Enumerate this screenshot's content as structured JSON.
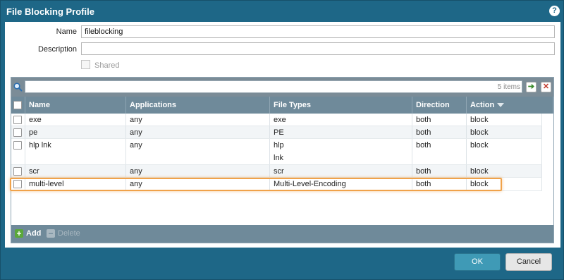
{
  "dialog": {
    "title": "File Blocking Profile",
    "help_icon": "help-icon"
  },
  "form": {
    "name_label": "Name",
    "name_value": "fileblocking",
    "description_label": "Description",
    "description_value": "",
    "shared_label": "Shared",
    "shared_checked": false
  },
  "grid": {
    "filter_value": "",
    "item_count": "5 items",
    "columns": [
      "Name",
      "Applications",
      "File Types",
      "Direction",
      "Action"
    ],
    "sorted_column": "Action",
    "rows": [
      {
        "name": "exe",
        "applications": "any",
        "file_types": [
          "exe"
        ],
        "direction": "both",
        "action": "block"
      },
      {
        "name": "pe",
        "applications": "any",
        "file_types": [
          "PE"
        ],
        "direction": "both",
        "action": "block"
      },
      {
        "name": "hlp lnk",
        "applications": "any",
        "file_types": [
          "hlp",
          "lnk"
        ],
        "direction": "both",
        "action": "block"
      },
      {
        "name": "scr",
        "applications": "any",
        "file_types": [
          "scr"
        ],
        "direction": "both",
        "action": "block"
      },
      {
        "name": "multi-level",
        "applications": "any",
        "file_types": [
          "Multi-Level-Encoding"
        ],
        "direction": "both",
        "action": "block"
      }
    ],
    "highlighted_row": "multi-level",
    "add_label": "Add",
    "delete_label": "Delete"
  },
  "buttons": {
    "ok_label": "OK",
    "cancel_label": "Cancel"
  },
  "colors": {
    "titlebar": "#1e6787",
    "grid_header": "#6f8a9a",
    "highlight": "#f0a24a",
    "ok_button": "#3f9ab6"
  }
}
